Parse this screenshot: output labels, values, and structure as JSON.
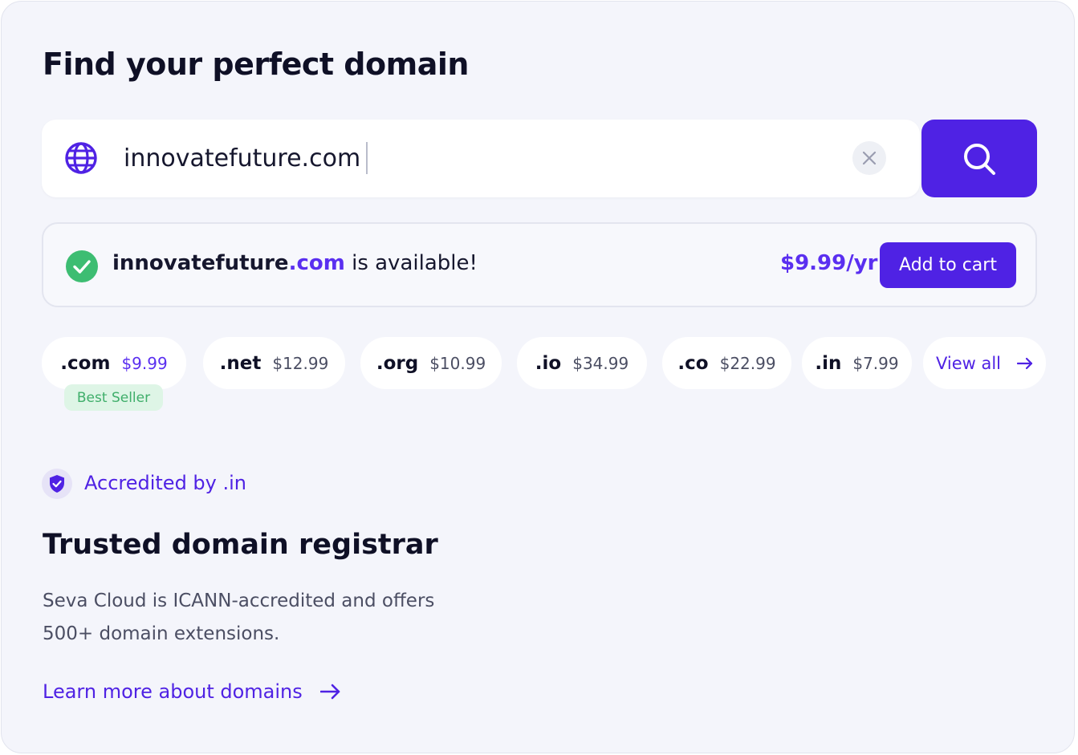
{
  "page": {
    "title": "Find your perfect domain"
  },
  "search": {
    "value": "innovatefuture.com",
    "icon": "globe-icon",
    "clear_icon": "close-icon",
    "button_icon": "search-icon"
  },
  "availability": {
    "domain_name": "innovatefuture",
    "domain_tld": ".com",
    "status_text": "is available!",
    "price": "$9.99/yr",
    "add_to_cart_label": "Add to cart",
    "icon": "check-circle-icon"
  },
  "tlds": [
    {
      "ext": ".com",
      "price": "$9.99"
    },
    {
      "ext": ".net",
      "price": "$12.99"
    },
    {
      "ext": ".org",
      "price": "$10.99"
    },
    {
      "ext": ".io",
      "price": "$34.99"
    },
    {
      "ext": ".co",
      "price": "$22.99"
    },
    {
      "ext": ".in",
      "price": "$7.99"
    }
  ],
  "view_all_label": "View all",
  "best_seller_label": "Best Seller",
  "accreditation": {
    "label": "Accredited by .in",
    "icon": "shield-check-icon"
  },
  "trust": {
    "title": "Trusted domain registrar",
    "line1": "Seva Cloud is ICANN-accredited and offers",
    "line2": "500+ domain extensions.",
    "link_label": "Learn more about domains"
  },
  "colors": {
    "accent": "#4f22e4",
    "accent_text": "#5a2ff0",
    "success": "#3dbd72",
    "background": "#f4f5fb"
  }
}
